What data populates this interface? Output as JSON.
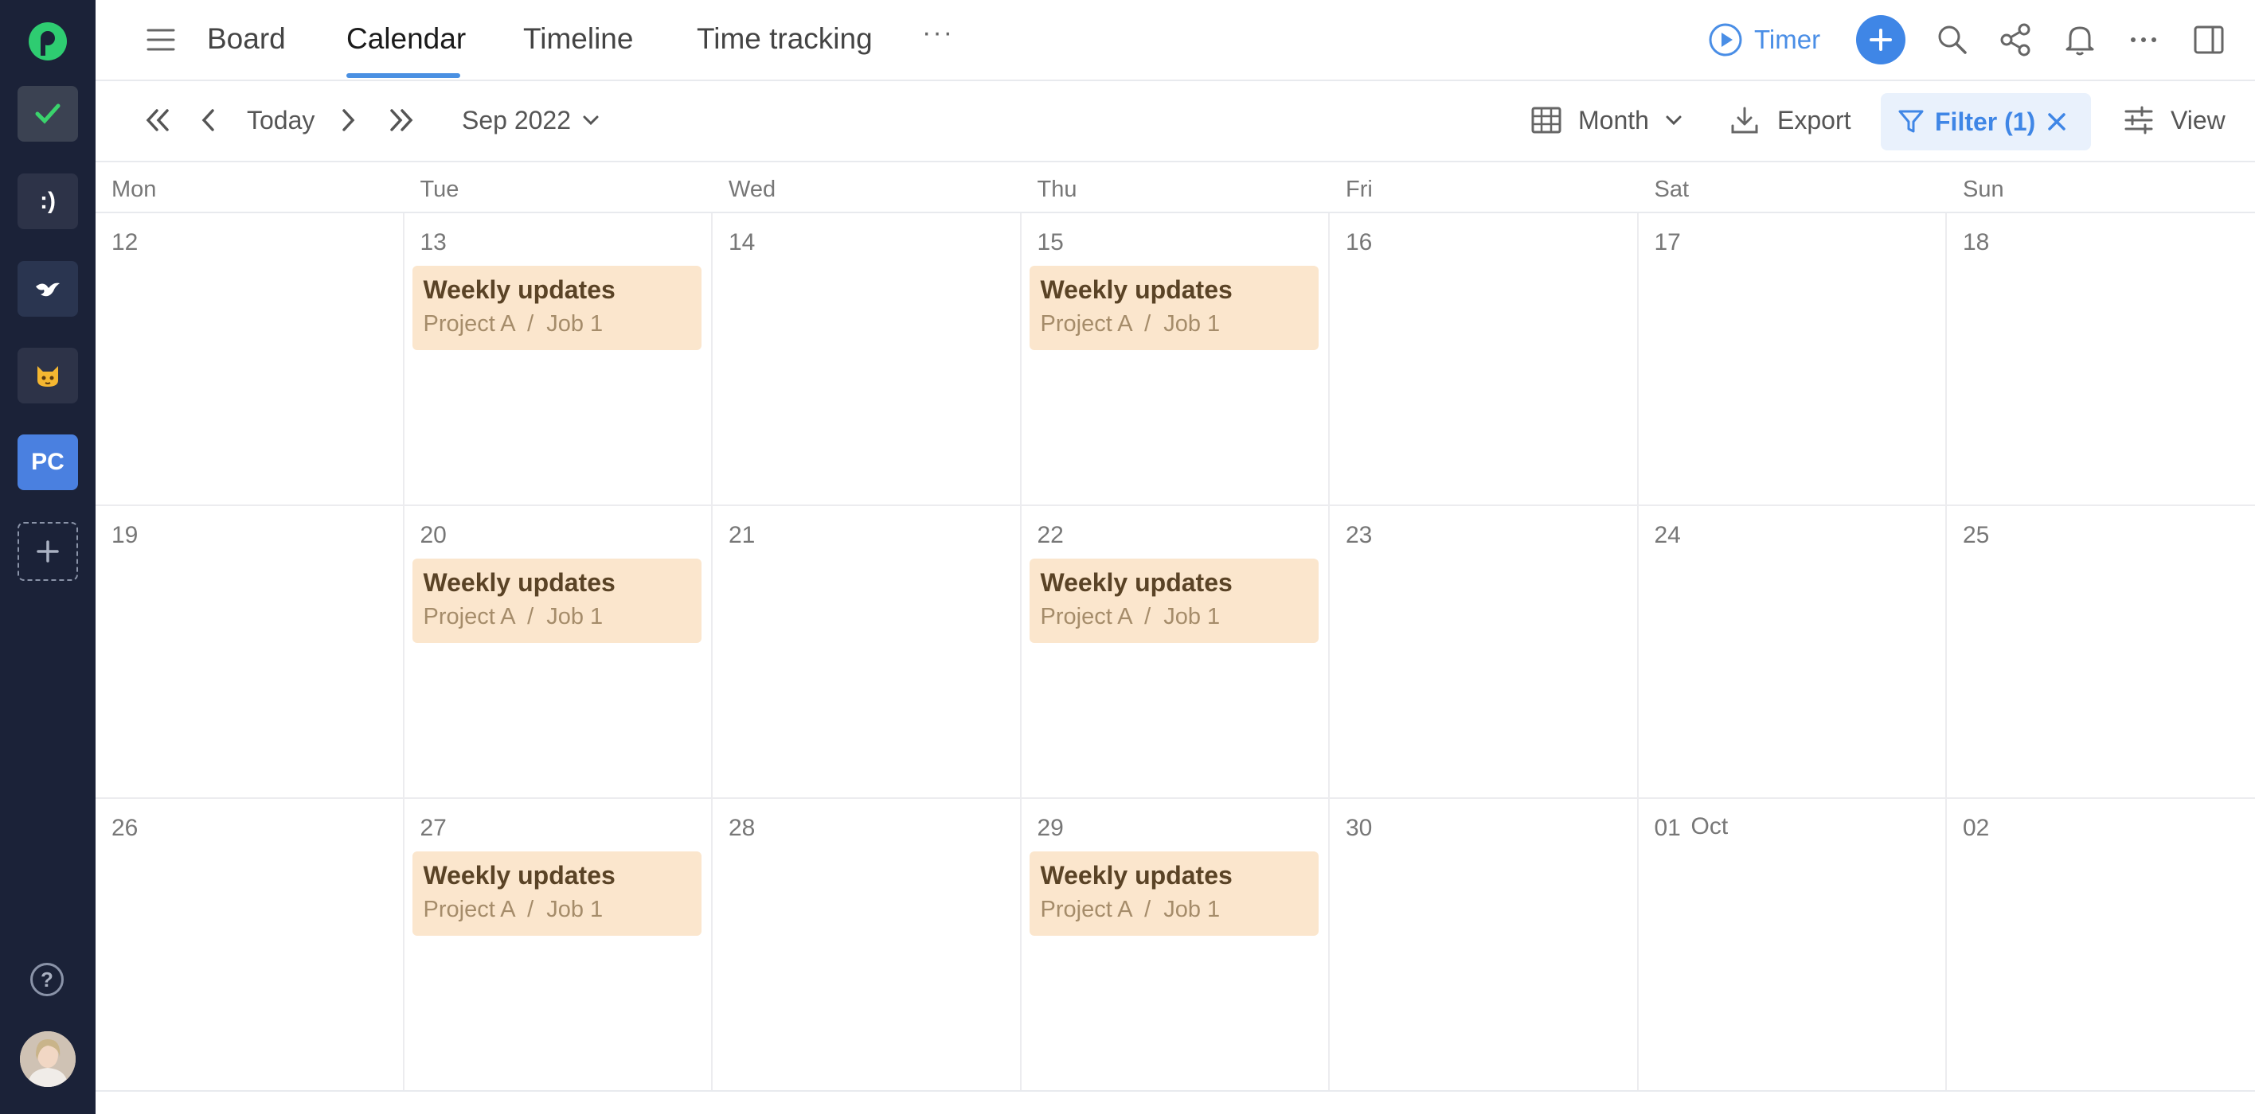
{
  "rail": {
    "workspaces": [
      {
        "id": "checklist",
        "label": "",
        "icon": "checkmark-icon"
      },
      {
        "id": "smiley",
        "label": ":)",
        "icon": ""
      },
      {
        "id": "bird",
        "label": "",
        "icon": "bird-icon"
      },
      {
        "id": "cat",
        "label": "",
        "icon": "cat-icon"
      },
      {
        "id": "pc",
        "label": "PC",
        "icon": ""
      }
    ],
    "help_label": "?"
  },
  "tabs": [
    {
      "label": "Board",
      "active": false
    },
    {
      "label": "Calendar",
      "active": true
    },
    {
      "label": "Timeline",
      "active": false
    },
    {
      "label": "Time tracking",
      "active": false
    }
  ],
  "tabs_more": "···",
  "actions": {
    "timer_label": "Timer",
    "icons": [
      "search-icon",
      "share-icon",
      "bell-icon",
      "more-icon",
      "panel-icon"
    ]
  },
  "toolbar": {
    "today_label": "Today",
    "period_label": "Sep 2022",
    "view_mode_label": "Month",
    "export_label": "Export",
    "filter_label": "Filter (1)",
    "view_label": "View"
  },
  "calendar": {
    "weekdays": [
      "Mon",
      "Tue",
      "Wed",
      "Thu",
      "Fri",
      "Sat",
      "Sun"
    ],
    "weeks": [
      {
        "days": [
          {
            "num": "12",
            "events": []
          },
          {
            "num": "13",
            "events": [
              {
                "title": "Weekly updates",
                "path": "Project A  /  Job 1"
              }
            ]
          },
          {
            "num": "14",
            "events": []
          },
          {
            "num": "15",
            "events": [
              {
                "title": "Weekly updates",
                "path": "Project A  /  Job 1"
              }
            ]
          },
          {
            "num": "16",
            "events": []
          },
          {
            "num": "17",
            "events": []
          },
          {
            "num": "18",
            "events": []
          }
        ]
      },
      {
        "days": [
          {
            "num": "19",
            "events": []
          },
          {
            "num": "20",
            "events": [
              {
                "title": "Weekly updates",
                "path": "Project A  /  Job 1"
              }
            ]
          },
          {
            "num": "21",
            "events": []
          },
          {
            "num": "22",
            "events": [
              {
                "title": "Weekly updates",
                "path": "Project A  /  Job 1"
              }
            ]
          },
          {
            "num": "23",
            "events": []
          },
          {
            "num": "24",
            "events": []
          },
          {
            "num": "25",
            "events": []
          }
        ]
      },
      {
        "days": [
          {
            "num": "26",
            "events": []
          },
          {
            "num": "27",
            "events": [
              {
                "title": "Weekly updates",
                "path": "Project A  /  Job 1"
              }
            ]
          },
          {
            "num": "28",
            "events": []
          },
          {
            "num": "29",
            "events": [
              {
                "title": "Weekly updates",
                "path": "Project A  /  Job 1"
              }
            ]
          },
          {
            "num": "30",
            "events": []
          },
          {
            "num": "01",
            "month": "Oct",
            "events": []
          },
          {
            "num": "02",
            "events": []
          }
        ]
      }
    ]
  },
  "colors": {
    "rail_bg": "#1b2238",
    "accent": "#3f86e6",
    "event_bg": "#fbe6cd",
    "event_title": "#5a4326",
    "event_sub": "#a58c6a",
    "logo_green": "#2ecc71"
  }
}
